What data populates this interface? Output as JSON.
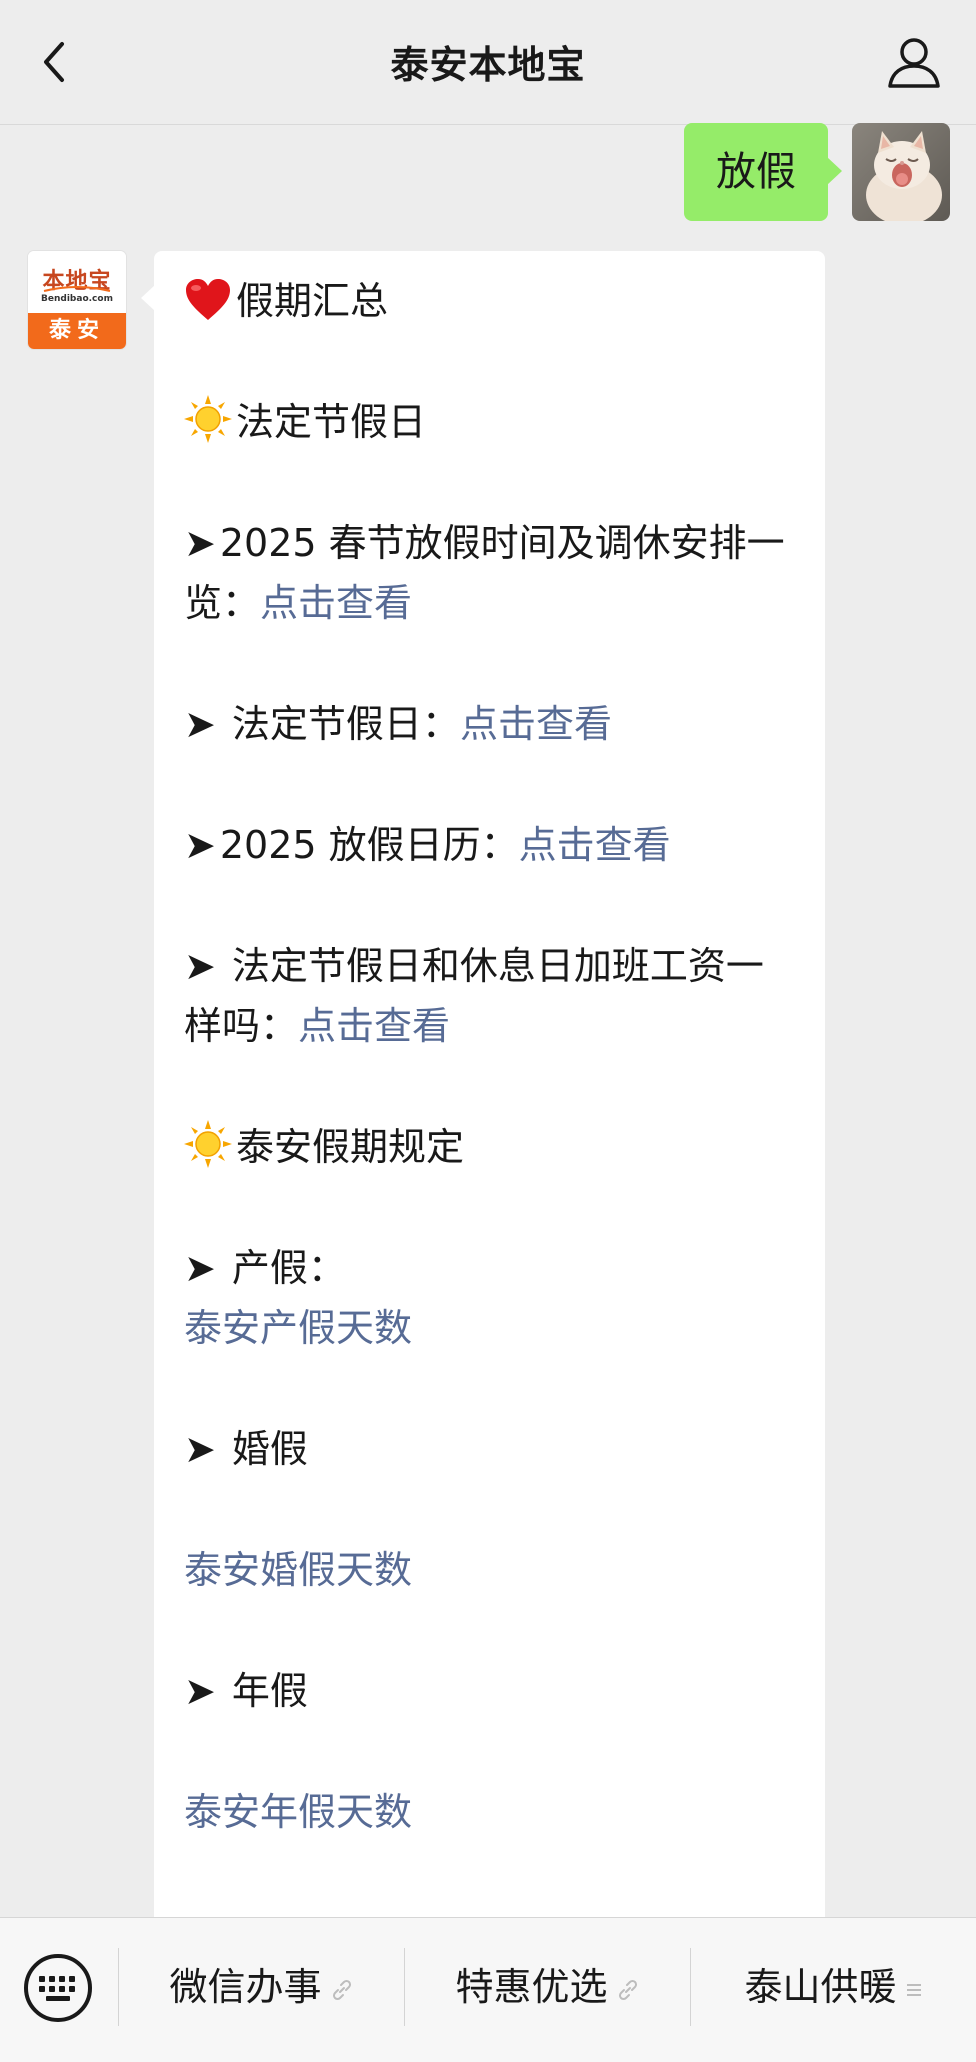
{
  "header": {
    "title": "泰安本地宝"
  },
  "chat": {
    "outgoing": {
      "text": "放假"
    },
    "incoming": {
      "sender_logo": {
        "top_text": "本地宝",
        "domain": "Bendibao.com",
        "city": "泰安"
      },
      "heading": "假期汇总",
      "section1": "法定节假日",
      "item1_text": "2025 春节放假时间及调休安排一览：",
      "item1_link": "点击查看",
      "item2_text": " 法定节假日：",
      "item2_link": "点击查看",
      "item3_text": "2025 放假日历：",
      "item3_link": "点击查看",
      "item4_text": " 法定节假日和休息日加班工资一样吗：",
      "item4_link": "点击查看",
      "section2": "泰安假期规定",
      "item5_text": " 产假：",
      "item5_link": "泰安产假天数",
      "item6_text": " 婚假",
      "item6_link": "泰安婚假天数",
      "item7_text": " 年假",
      "item7_link": "泰安年假天数",
      "arrow": "➤",
      "icons": {
        "heading": "heart-icon",
        "section": "sun-icon"
      }
    }
  },
  "menu": {
    "items": [
      {
        "label": "微信办事",
        "icon": "link-icon"
      },
      {
        "label": "特惠优选",
        "icon": "link-icon"
      },
      {
        "label": "泰山供暖",
        "icon": "menu-lines-icon"
      }
    ]
  },
  "colors": {
    "background": "#ededed",
    "outgoing_bubble": "#95ec69",
    "incoming_bubble": "#ffffff",
    "link": "#576b95",
    "brand_orange": "#f26a1b"
  }
}
